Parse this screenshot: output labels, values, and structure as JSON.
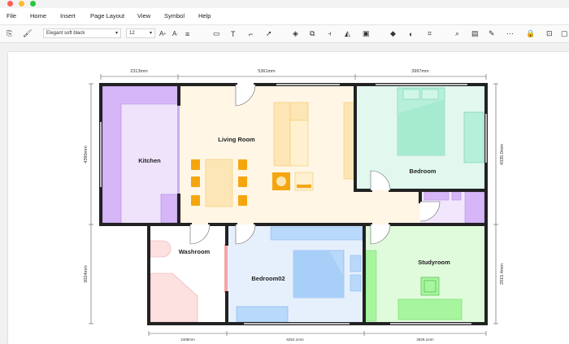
{
  "menu": {
    "file": "File",
    "home": "Home",
    "insert": "Insert",
    "page_layout": "Page Layout",
    "view": "View",
    "symbol": "Symbol",
    "help": "Help"
  },
  "toolbar": {
    "font_name": "Elegant soft black",
    "font_size": "12"
  },
  "icons": [
    "copy-icon",
    "format-painter-icon",
    "font-grow-icon",
    "font-shrink-icon",
    "align-icon",
    "rectangle-icon",
    "text-icon",
    "connector-icon",
    "pointer-icon",
    "layers-icon",
    "group-icon",
    "align-left-icon",
    "flip-icon",
    "frame-icon",
    "fill-icon",
    "shadow-icon",
    "crop-icon",
    "search-icon",
    "note-icon",
    "line-color-icon",
    "line-style-icon",
    "lock-icon",
    "fit-icon",
    "more-icon"
  ],
  "colors": {
    "wall": "#222222",
    "kitchen": "#e6d6f9",
    "living": "#fff6e6",
    "bedroom": "#dff7ee",
    "bedroom02": "#e3effd",
    "studyroom": "#dcfbd8",
    "washroom": "#fdeeee",
    "furniture_orange": "#f5a60f",
    "furniture_purple": "#d9b8f8"
  },
  "plan": {
    "rooms": {
      "kitchen": "Kitchen",
      "living": "Living Room",
      "bedroom": "Bedroom",
      "washroom": "Washroom",
      "bedroom02": "Bedroom02",
      "studyroom": "Studyroom"
    },
    "dims": {
      "top1": "2313mm",
      "top2": "5361mm",
      "top3": "3997mm",
      "left1": "4390mm",
      "left2": "3024mm",
      "right1": "4335.0mm",
      "right2": "2915.4mm",
      "bottom1": "2408mm",
      "bottom2": "6252.1mm",
      "bottom3": "3929.1mm"
    }
  }
}
